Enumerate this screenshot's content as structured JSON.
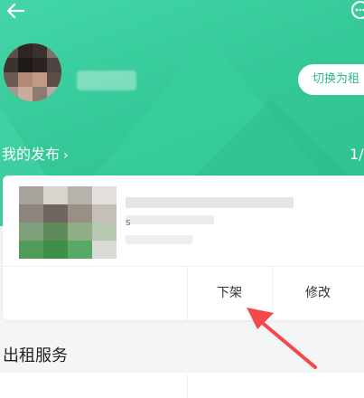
{
  "header": {
    "back_icon": "arrow-left-icon",
    "more_icon": "more-options-icon"
  },
  "profile": {
    "switch_button_label": "切换为租"
  },
  "publications": {
    "title": "我的发布",
    "chevron": "›",
    "page_indicator": "1/"
  },
  "listing": {
    "stray_char": "s",
    "action_unlist": "下架",
    "action_edit": "修改"
  },
  "services": {
    "title": "出租服务"
  },
  "colors": {
    "hero_green": "#35c899",
    "accent": "#2fb98a",
    "annotation_arrow": "#f24a4a"
  }
}
